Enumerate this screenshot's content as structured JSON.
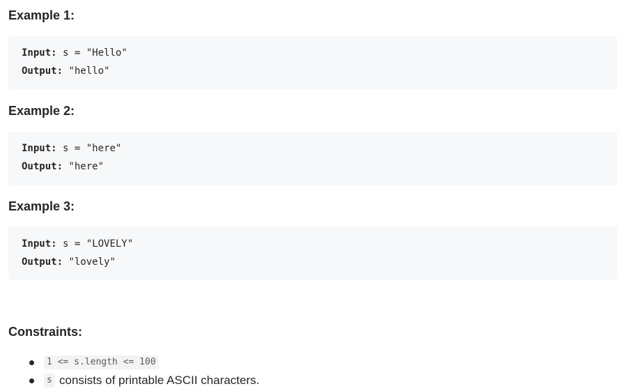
{
  "examples": [
    {
      "heading": "Example 1:",
      "input_label": "Input:",
      "input_value": "s = \"Hello\"",
      "output_label": "Output:",
      "output_value": "\"hello\""
    },
    {
      "heading": "Example 2:",
      "input_label": "Input:",
      "input_value": "s = \"here\"",
      "output_label": "Output:",
      "output_value": "\"here\""
    },
    {
      "heading": "Example 3:",
      "input_label": "Input:",
      "input_value": "s = \"LOVELY\"",
      "output_label": "Output:",
      "output_value": "\"lovely\""
    }
  ],
  "constraints": {
    "heading": "Constraints:",
    "items": [
      {
        "code": "1 <= s.length <= 100",
        "text": ""
      },
      {
        "code": "s",
        "text": "consists of printable ASCII characters."
      }
    ]
  }
}
